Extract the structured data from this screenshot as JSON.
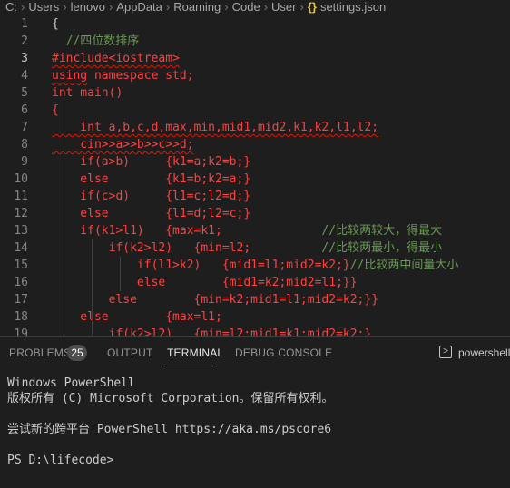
{
  "breadcrumb": {
    "items": [
      "C:",
      "Users",
      "lenovo",
      "AppData",
      "Roaming",
      "Code",
      "User"
    ],
    "file_icon": "{}",
    "file_name": "settings.json"
  },
  "editor": {
    "lines": [
      {
        "n": "1",
        "segs": [
          {
            "t": "{",
            "c": "white"
          }
        ]
      },
      {
        "n": "2",
        "segs": [
          {
            "t": "  //四位数排序",
            "c": "green"
          }
        ]
      },
      {
        "n": "3",
        "segs": [
          {
            "t": "#include<iostream>",
            "c": "red",
            "sq": true
          }
        ]
      },
      {
        "n": "4",
        "segs": [
          {
            "t": "using",
            "c": "red",
            "sq": true
          },
          {
            "t": " namespace std;",
            "c": "red"
          }
        ]
      },
      {
        "n": "5",
        "segs": [
          {
            "t": "int main()",
            "c": "red"
          }
        ]
      },
      {
        "n": "6",
        "segs": [
          {
            "t": "{",
            "c": "red"
          }
        ]
      },
      {
        "n": "7",
        "segs": [
          {
            "t": "    int a,b,c,d,max,min,mid1,mid2,k1,k2,l1,l2;",
            "c": "red",
            "sq": true
          }
        ]
      },
      {
        "n": "8",
        "segs": [
          {
            "t": "    cin>>a>>b>>c>>d;",
            "c": "red",
            "sq": true
          }
        ]
      },
      {
        "n": "9",
        "segs": [
          {
            "t": "    if(a>b)     {k1=a;k2=b;}",
            "c": "red"
          }
        ]
      },
      {
        "n": "10",
        "segs": [
          {
            "t": "    else        {k1=b;k2=a;}",
            "c": "red"
          }
        ]
      },
      {
        "n": "11",
        "segs": [
          {
            "t": "    if(c>d)     {l1=c;l2=d;}",
            "c": "red"
          }
        ]
      },
      {
        "n": "12",
        "segs": [
          {
            "t": "    else        {l1=d;l2=c;}",
            "c": "red"
          }
        ]
      },
      {
        "n": "13",
        "segs": [
          {
            "t": "    if(k1>l1)   {max=k1;              ",
            "c": "red"
          },
          {
            "t": "//比较两较大，得最大",
            "c": "green"
          }
        ]
      },
      {
        "n": "14",
        "segs": [
          {
            "t": "        if(k2>l2)   {min=l2;          ",
            "c": "red"
          },
          {
            "t": "//比较两最小，得最小",
            "c": "green"
          }
        ]
      },
      {
        "n": "15",
        "segs": [
          {
            "t": "            if(l1>k2)   {mid1=l1;mid2=k2;}",
            "c": "red"
          },
          {
            "t": "//比较两中间量大小",
            "c": "green"
          }
        ]
      },
      {
        "n": "16",
        "segs": [
          {
            "t": "            else        {mid1=k2;mid2=l1;}}",
            "c": "red"
          }
        ]
      },
      {
        "n": "17",
        "segs": [
          {
            "t": "        else        {min=k2;mid1=l1;mid2=k2;}}",
            "c": "red"
          }
        ]
      },
      {
        "n": "18",
        "segs": [
          {
            "t": "    else        {max=l1;",
            "c": "red"
          }
        ]
      },
      {
        "n": "19",
        "segs": [
          {
            "t": "        if(k2>l2)   {min=l2;mid1=k1;mid2=k2;}",
            "c": "red"
          }
        ]
      }
    ]
  },
  "panel": {
    "tabs": {
      "problems": "PROBLEMS",
      "problems_count": "25",
      "output": "OUTPUT",
      "terminal": "TERMINAL",
      "debug": "DEBUG CONSOLE"
    },
    "shell_label": "powershell",
    "shell_icon": "terminal-icon"
  },
  "terminal": {
    "lines": [
      "Windows PowerShell",
      "版权所有 (C) Microsoft Corporation。保留所有权利。",
      "",
      "尝试新的跨平台 PowerShell https://aka.ms/pscore6",
      "",
      "PS D:\\lifecode>"
    ]
  },
  "colors": {
    "background": "#1e1e1e",
    "code_red": "#ff4040",
    "comment_green": "#6a9955",
    "line_number": "#858585"
  }
}
